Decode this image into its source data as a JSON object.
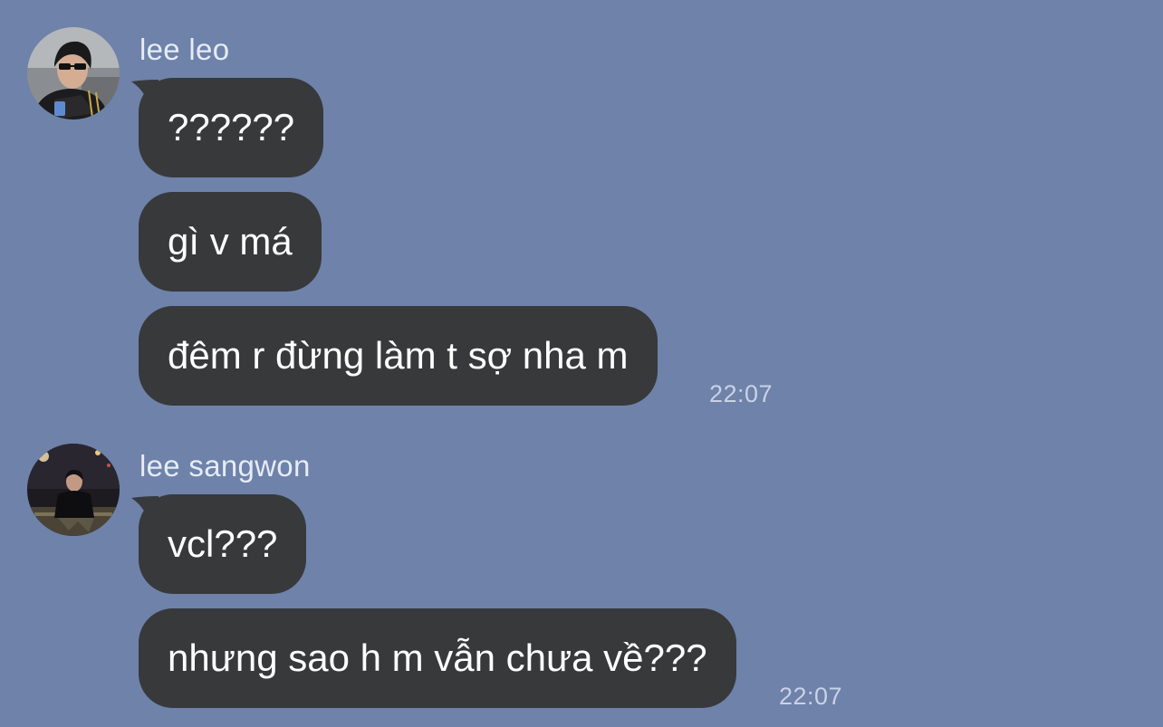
{
  "colors": {
    "background": "#6e82aa",
    "bubble": "#38393b",
    "bubble_text": "#ffffff",
    "meta_text": "#c9d2e6"
  },
  "groups": [
    {
      "sender": "lee leo",
      "avatar": "user-avatar-photo-sunglasses",
      "messages": [
        "??????",
        "gì v má",
        "đêm r đừng làm t sợ nha m"
      ],
      "time": "22:07"
    },
    {
      "sender": "lee sangwon",
      "avatar": "user-avatar-photo-night",
      "messages": [
        "vcl???",
        "nhưng sao h m vẫn chưa về???"
      ],
      "time": "22:07"
    }
  ]
}
